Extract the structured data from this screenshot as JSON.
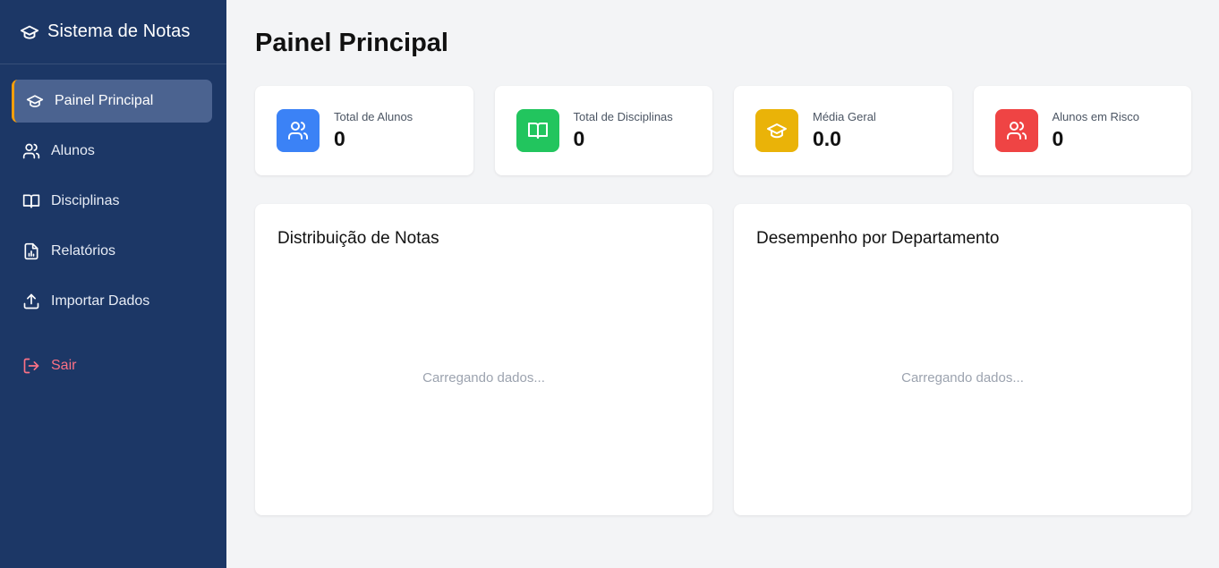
{
  "app": {
    "title": "Sistema de Notas"
  },
  "sidebar": {
    "items": [
      {
        "label": "Painel Principal",
        "icon": "graduation-cap-icon",
        "active": true
      },
      {
        "label": "Alunos",
        "icon": "users-icon"
      },
      {
        "label": "Disciplinas",
        "icon": "book-icon"
      },
      {
        "label": "Relatórios",
        "icon": "report-icon"
      },
      {
        "label": "Importar Dados",
        "icon": "upload-icon"
      }
    ],
    "logout": {
      "label": "Sair",
      "icon": "logout-icon"
    }
  },
  "page": {
    "title": "Painel Principal"
  },
  "stats": [
    {
      "label": "Total de Alunos",
      "value": "0",
      "icon": "users-icon",
      "color": "#3b82f6"
    },
    {
      "label": "Total de Disciplinas",
      "value": "0",
      "icon": "book-icon",
      "color": "#22c55e"
    },
    {
      "label": "Média Geral",
      "value": "0.0",
      "icon": "graduation-cap-icon",
      "color": "#eab308"
    },
    {
      "label": "Alunos em Risco",
      "value": "0",
      "icon": "users-icon",
      "color": "#ef4444"
    }
  ],
  "charts": [
    {
      "title": "Distribuição de Notas",
      "status": "Carregando dados..."
    },
    {
      "title": "Desempenho por Departamento",
      "status": "Carregando dados..."
    }
  ],
  "colors": {
    "sidebar_bg": "#1c3766",
    "active_item_bg": "#4b6390",
    "active_accent": "#f59e0b",
    "logout": "#fb7185",
    "page_bg": "#f3f4f6"
  }
}
